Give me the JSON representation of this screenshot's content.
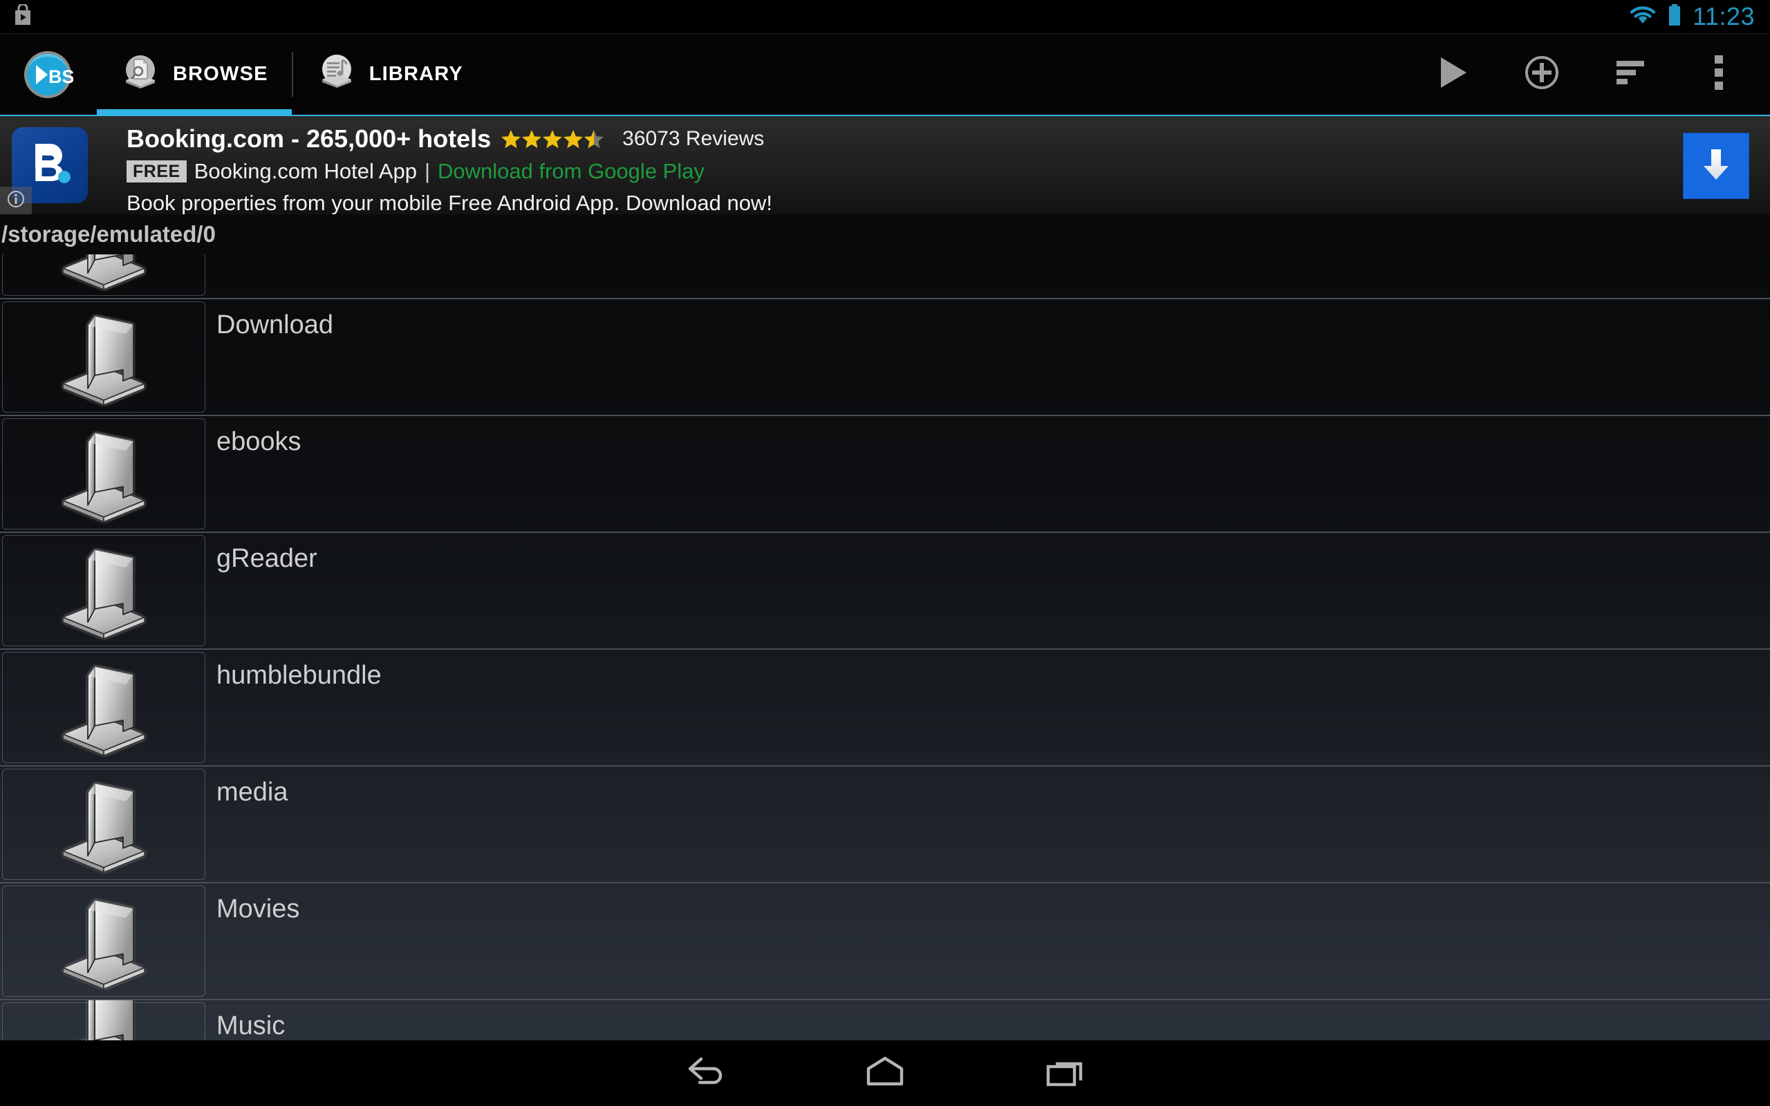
{
  "status_bar": {
    "notification_icon": "play-store-bag-icon",
    "wifi_icon": "wifi-icon",
    "battery_icon": "battery-icon",
    "time": "11:23",
    "accent_color": "#2196c4"
  },
  "action_bar": {
    "app_logo": "bubbleupnp-bs-logo",
    "accent_color": "#33b5e5",
    "tabs": [
      {
        "label": "BROWSE",
        "icon": "browse-document-search-icon",
        "active": true
      },
      {
        "label": "LIBRARY",
        "icon": "library-music-list-icon",
        "active": false
      }
    ],
    "actions": [
      {
        "name": "play-button",
        "icon": "play-icon"
      },
      {
        "name": "add-button",
        "icon": "plus-circle-icon"
      },
      {
        "name": "sort-button",
        "icon": "sort-lines-icon"
      },
      {
        "name": "overflow-button",
        "icon": "overflow-menu-icon"
      }
    ]
  },
  "ad": {
    "icon": "booking-com-logo",
    "icon_letter": "B",
    "title": "Booking.com - 265,000+ hotels",
    "rating": 4.5,
    "reviews": "36073 Reviews",
    "price_badge": "FREE",
    "subtitle": "Booking.com Hotel App",
    "separator": "|",
    "link": "Download from Google Play",
    "link_color": "#1d9c3e",
    "description": "Book properties from your mobile Free Android App. Download now!",
    "download_button_icon": "download-arrow-icon",
    "download_button_color": "#1769e0",
    "info_badge_icon": "ad-info-icon"
  },
  "path_bar": {
    "path": "/storage/emulated/0"
  },
  "file_list": {
    "folder_icon": "folder-3d-icon",
    "items": [
      {
        "name": "",
        "clip": "top"
      },
      {
        "name": "Download"
      },
      {
        "name": "ebooks"
      },
      {
        "name": "gReader"
      },
      {
        "name": "humblebundle"
      },
      {
        "name": "media"
      },
      {
        "name": "Movies"
      },
      {
        "name": "Music",
        "clip": "bottom"
      }
    ]
  },
  "nav_bar": {
    "buttons": [
      {
        "name": "back-button",
        "icon": "back-arrow-icon"
      },
      {
        "name": "home-button",
        "icon": "home-icon"
      },
      {
        "name": "recents-button",
        "icon": "recents-icon"
      }
    ]
  }
}
